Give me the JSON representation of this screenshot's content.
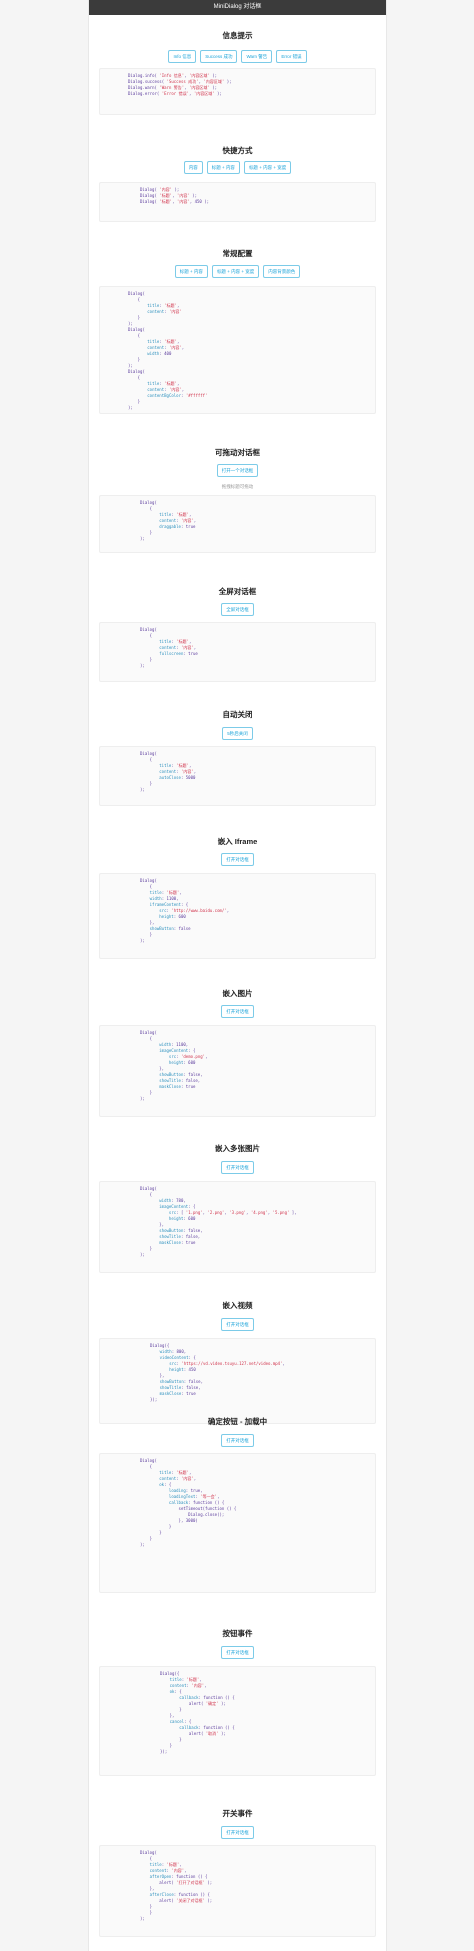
{
  "window": {
    "title": "MiniDialog 对话框"
  },
  "sections": [
    {
      "title": "信息提示",
      "buttons": [
        "Info 信息",
        "Success 成功",
        "Warn 警告",
        "Error 错误"
      ],
      "code": [
        "Dialog.info( 'Info 信息', '内容区域' );",
        "Dialog.success( 'Success 成功', '内容区域' );",
        "Dialog.warn( 'Warn 警告', '内容区域' );",
        "Dialog.error( 'Error 错误', '内容区域' );"
      ]
    },
    {
      "title": "快捷方式",
      "buttons": [
        "内容",
        "标题 + 内容",
        "标题 + 内容 + 宽度"
      ],
      "code": [
        "Dialog( '内容' );",
        "Dialog( '标题', '内容' );",
        "Dialog( '标题', '内容', 450 );"
      ]
    },
    {
      "title": "常规配置",
      "buttons": [
        "标题 + 内容",
        "标题 + 内容 + 宽度",
        "内容背景颜色"
      ],
      "code": [
        "Dialog(",
        "    {",
        "        title: '标题',",
        "        content: '内容'",
        "    }",
        ");",
        "Dialog(",
        "    {",
        "        title: '标题',",
        "        content: '内容',",
        "        width: 400",
        "    }",
        ");",
        "Dialog(",
        "    {",
        "        title: '标题',",
        "        content: '内容',",
        "        contentBgColor: '#ffffff'",
        "    }",
        ");"
      ]
    },
    {
      "title": "可拖动对话框",
      "buttons": [
        "打开一个对话框"
      ],
      "hint": "拖拽标题可拖动",
      "code": [
        "Dialog(",
        "    {",
        "        title: '标题',",
        "        content: '内容',",
        "        draggable: true",
        "    }",
        ");"
      ]
    },
    {
      "title": "全屏对话框",
      "buttons": [
        "全屏对话框"
      ],
      "code": [
        "Dialog(",
        "    {",
        "        title: '标题',",
        "        content: '内容',",
        "        fullscreen: true",
        "    }",
        ");"
      ]
    },
    {
      "title": "自动关闭",
      "buttons": [
        "5秒后关闭"
      ],
      "code": [
        "Dialog(",
        "    {",
        "        title: '标题',",
        "        content: '内容',",
        "        autoClose: 5000",
        "    }",
        ");"
      ]
    },
    {
      "title": "嵌入 Iframe",
      "buttons": [
        "打开对话框"
      ],
      "code": [
        "Dialog(",
        "    {",
        "    title: '标题',",
        "    width: 1100,",
        "    iframeContent: {",
        "        src: 'http://www.baidu.com/',",
        "        height: 600",
        "    },",
        "    showButton: false",
        "    }",
        ");"
      ]
    },
    {
      "title": "嵌入图片",
      "buttons": [
        "打开对话框"
      ],
      "code": [
        "Dialog(",
        "    {",
        "        width: 1100,",
        "        imageContent: {",
        "            src: 'demo.png',",
        "            height: 600",
        "        },",
        "        showButton: false,",
        "        showTitle: false,",
        "        maskClose: true",
        "    }",
        ");"
      ]
    },
    {
      "title": "嵌入多张图片",
      "buttons": [
        "打开对话框"
      ],
      "code": [
        "Dialog(",
        "    {",
        "        width: 780,",
        "        imageContent: {",
        "            src: [ '1.png', '2.png', '3.png', '4.png', '5.png' ],",
        "            height: 600",
        "        },",
        "        showButton: false,",
        "        showTitle: false,",
        "        maskClose: true",
        "    }",
        ");"
      ]
    },
    {
      "title": "嵌入视频",
      "buttons": [
        "打开对话框"
      ],
      "code": [
        "Dialog({",
        "    width: 800,",
        "    videoContent: {",
        "        src: 'https://vd.video.tsuyu.127.net/video.mp4',",
        "        height: 450",
        "    },",
        "    showButton: false,",
        "    showTitle: false,",
        "    maskClose: true",
        "});"
      ]
    },
    {
      "title": "确定按钮 - 加载中",
      "buttons": [
        "打开对话框"
      ],
      "code": [
        "Dialog(",
        "    {",
        "        title: '标题',",
        "        content: '内容',",
        "        ok: {",
        "            loading: true,",
        "            loadingText: '等一会',",
        "            callback: function () {",
        "                setTimeout(function () {",
        "                    Dialog.close();",
        "                }, 3000)",
        "            }",
        "        }",
        "    }",
        ");"
      ]
    },
    {
      "title": "按钮事件",
      "buttons": [
        "打开对话框"
      ],
      "code": [
        "Dialog({",
        "    title: '标题',",
        "    content: '内容',",
        "    ok: {",
        "        callback: function () {",
        "            alert( '确定' );",
        "        }",
        "    },",
        "    cancel: {",
        "        callback: function () {",
        "            alert( '取消' );",
        "        }",
        "    }",
        "});"
      ]
    },
    {
      "title": "开关事件",
      "buttons": [
        "打开对话框"
      ],
      "code": [
        "Dialog(",
        "    {",
        "    title: '标题',",
        "    content: '内容',",
        "    afterOpen: function () {",
        "        alert( '打开了对话框' );",
        "    },",
        "    afterClose: function () {",
        "        alert( '关闭了对话框' );",
        "    }",
        "    }",
        ");"
      ]
    }
  ]
}
